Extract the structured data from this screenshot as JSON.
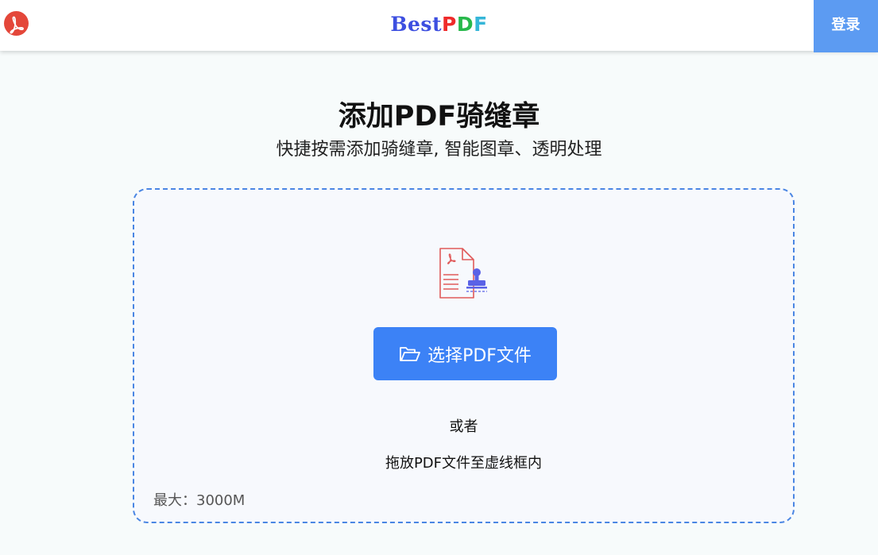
{
  "header": {
    "brand": {
      "part1": "Best",
      "part2": "P",
      "part3": "D",
      "part4": "F"
    },
    "login_label": "登录",
    "logo_icon": "pdf-logo-icon"
  },
  "main": {
    "title": "添加PDF骑缝章",
    "subtitle": "快捷按需添加骑缝章, 智能图章、透明处理"
  },
  "dropzone": {
    "icon": "pdf-stamp-icon",
    "select_button": {
      "icon": "folder-open-icon",
      "label": "选择PDF文件"
    },
    "or_text": "或者",
    "drag_hint": "拖放PDF文件至虚线框内",
    "max_size": "最大：3000M"
  },
  "colors": {
    "accent": "#3c82f6",
    "login_bg": "#5c9bf2",
    "logo": "#e4473a",
    "dash_border": "#4a86e3"
  }
}
